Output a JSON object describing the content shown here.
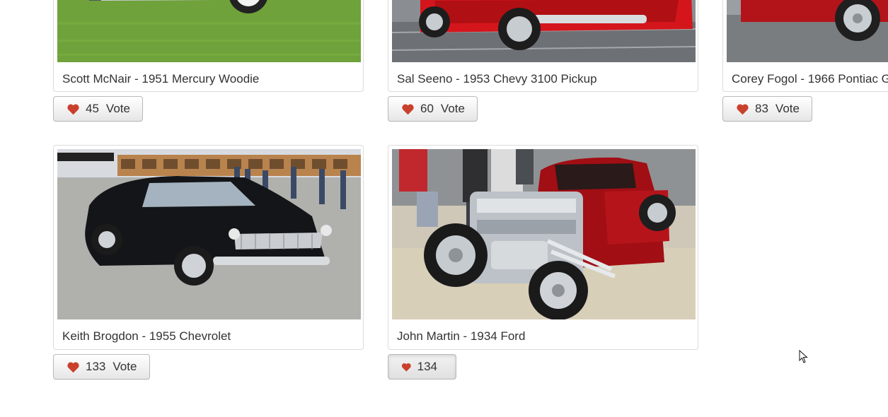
{
  "colors": {
    "heart": "#c9402c",
    "card_border": "#dcdcdc",
    "text": "#333333"
  },
  "cards": [
    {
      "caption": "Scott McNair - 1951 Mercury Woodie",
      "votes": "45",
      "vote_label": "Vote",
      "voted": false,
      "photo_icon": "car-photo"
    },
    {
      "caption": "Sal Seeno - 1953 Chevy 3100 Pickup",
      "votes": "60",
      "vote_label": "Vote",
      "voted": false,
      "photo_icon": "car-photo"
    },
    {
      "caption": "Corey Fogol - 1966 Pontiac G",
      "votes": "83",
      "vote_label": "Vote",
      "voted": false,
      "photo_icon": "car-photo"
    },
    {
      "caption": "Keith Brogdon - 1955 Chevrolet",
      "votes": "133",
      "vote_label": "Vote",
      "voted": false,
      "photo_icon": "car-photo"
    },
    {
      "caption": "John Martin - 1934 Ford",
      "votes": "134",
      "vote_label": "",
      "voted": true,
      "photo_icon": "car-photo"
    }
  ],
  "cursor_icon": "mouse-pointer-icon"
}
